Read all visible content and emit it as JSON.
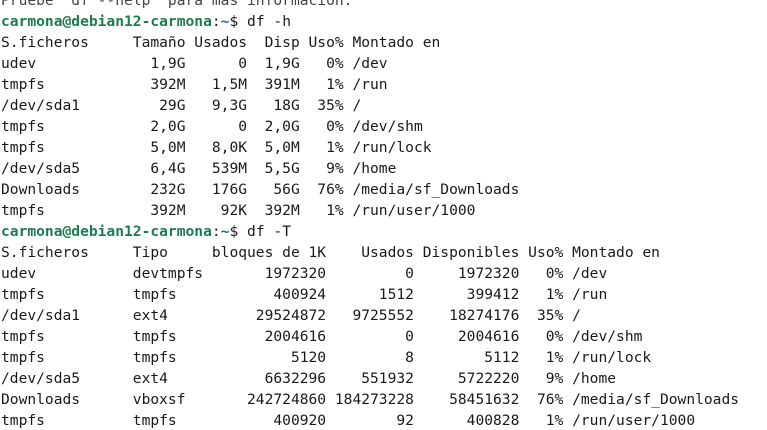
{
  "terminal": {
    "clipped_top_line": "Pruebe 'df --help' para más información.",
    "prompt": {
      "user_host": "carmona@debian12-carmona",
      "sep": ":",
      "path": "~",
      "symbol": "$"
    },
    "commands": [
      {
        "cmd": " df -h",
        "output": [
          "S.ficheros     Tamaño Usados  Disp Uso% Montado en",
          "udev             1,9G      0  1,9G   0% /dev",
          "tmpfs            392M   1,5M  391M   1% /run",
          "/dev/sda1         29G   9,3G   18G  35% /",
          "tmpfs            2,0G      0  2,0G   0% /dev/shm",
          "tmpfs            5,0M   8,0K  5,0M   1% /run/lock",
          "/dev/sda5        6,4G   539M  5,5G   9% /home",
          "Downloads        232G   176G   56G  76% /media/sf_Downloads",
          "tmpfs            392M    92K  392M   1% /run/user/1000"
        ]
      },
      {
        "cmd": " df -T",
        "output": [
          "S.ficheros     Tipo     bloques de 1K    Usados Disponibles Uso% Montado en",
          "udev           devtmpfs       1972320         0     1972320   0% /dev",
          "tmpfs          tmpfs           400924      1512      399412   1% /run",
          "/dev/sda1      ext4          29524872   9725552    18274176  35% /",
          "tmpfs          tmpfs          2004616         0     2004616   0% /dev/shm",
          "tmpfs          tmpfs             5120         8        5112   1% /run/lock",
          "/dev/sda5      ext4           6632296    551932     5722220   9% /home",
          "Downloads      vboxsf       242724860 184273228    58451632  76% /media/sf_Downloads",
          "tmpfs          tmpfs           400920        92      400828   1% /run/user/1000"
        ]
      }
    ]
  }
}
